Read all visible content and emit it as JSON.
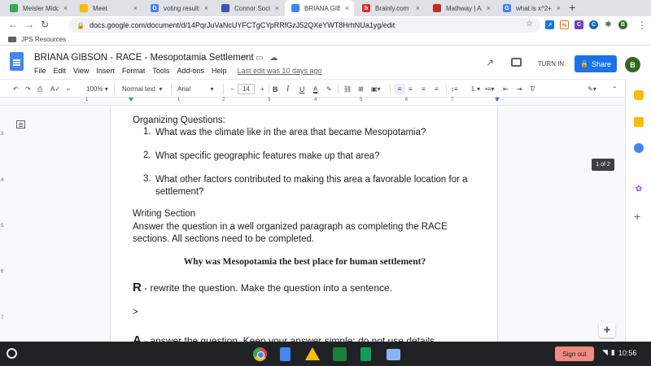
{
  "tabs": [
    {
      "title": "Meisler Middle",
      "color": "#34a853",
      "letter": "",
      "active": false
    },
    {
      "title": "Meet",
      "color": "#fbbc04",
      "letter": "",
      "active": false
    },
    {
      "title": "voting results -",
      "color": "#4285f4",
      "letter": "G",
      "active": false
    },
    {
      "title": "Connor Social",
      "color": "#3f51b5",
      "letter": "",
      "active": false
    },
    {
      "title": "BRIANA GIBSON",
      "color": "#4285f4",
      "letter": "",
      "active": true
    },
    {
      "title": "Brainly.com - F",
      "color": "#d93025",
      "letter": "b",
      "active": false
    },
    {
      "title": "Mathway | Alge",
      "color": "#c62828",
      "letter": "",
      "active": false
    },
    {
      "title": "what is x^2+6",
      "color": "#4285f4",
      "letter": "G",
      "active": false
    }
  ],
  "new_tab": "+",
  "address": {
    "url": "docs.google.com/document/d/14PqrJuVaNcUYFCTgCYpRRfGzJ52QXeYWT8HrhNUa1yg/edit"
  },
  "bookmarks": {
    "folder_label": "JPS Resources"
  },
  "doc_header": {
    "title": "BRIANA GIBSON - RACE - Mesopotamia Settlement",
    "menu": [
      "File",
      "Edit",
      "View",
      "Insert",
      "Format",
      "Tools",
      "Add-ons",
      "Help"
    ],
    "last_edit": "Last edit was 10 days ago",
    "turn_in_label": "TURN IN",
    "share_label": "Share",
    "avatar_letter": "B"
  },
  "toolbar": {
    "zoom": "100%",
    "style": "Normal text",
    "font": "Arial",
    "font_size": "14",
    "bold": "B",
    "italic": "I",
    "underline": "U",
    "text_color": "A",
    "minus": "−",
    "plus": "+"
  },
  "ruler": {
    "numbers": [
      "1",
      "1",
      "2",
      "3",
      "4",
      "5",
      "6",
      "7",
      "8"
    ]
  },
  "vruler": {
    "numbers": [
      "3",
      "4",
      "5",
      "6",
      "7"
    ]
  },
  "document": {
    "organizing_heading": "Organizing Questions:",
    "questions": [
      {
        "num": "1.",
        "text": "What was the climate like in the area that became Mesopotamia?"
      },
      {
        "num": "2.",
        "text": "What specific geographic features make up that area?"
      },
      {
        "num": "3.",
        "text": "What other factors contributed to making this area a favorable location for a settlement?"
      }
    ],
    "writing_heading": "Writing Section",
    "writing_instructions": "Answer the question in a well organized paragraph as completing the RACE sections.  All sections need to be completed.",
    "main_question": "Why was Mesopotamia the best place for human settlement?",
    "r_letter": "R",
    "r_text": " - rewrite the question.  Make the question into a sentence.",
    "prompt_marker": ">",
    "a_letter": "A",
    "a_text": " - answer the question.  Keep your answer simple; do not use details."
  },
  "page_indicator": "1 of 2",
  "taskbar": {
    "sign_out": "Sign out",
    "time": "10:56"
  }
}
